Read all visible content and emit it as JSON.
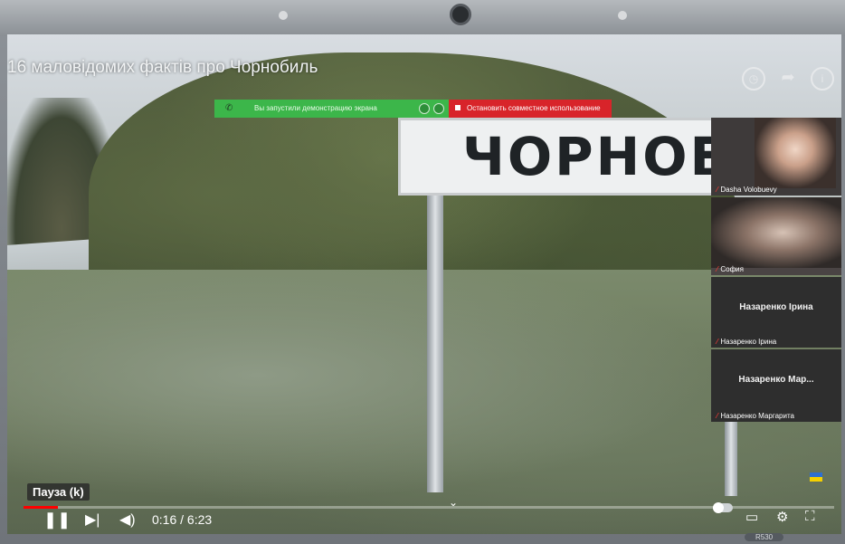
{
  "video": {
    "title": "16 маловідомих фактів про Чорнобиль",
    "sign_text": "ЧОРНОБИЛЬ",
    "pause_tooltip": "Пауза (k)",
    "time": "0:16 / 6:23",
    "progress": 0.042
  },
  "share_bar": {
    "notice": "Вы запустили демонстрацию экрана",
    "stop_label": "Остановить совместное использование",
    "notice_color": "#3cb64a",
    "stop_color": "#d8242a"
  },
  "participants": [
    {
      "name": "Dasha Volobuevy",
      "has_video": true
    },
    {
      "name": "София",
      "has_video": true
    },
    {
      "name": "Назаренко Ірина",
      "center_label": "Назаренко Ірина",
      "has_video": false
    },
    {
      "name": "Назаренко Маргарита",
      "center_label": "Назаренко Мар...",
      "has_video": false
    }
  ],
  "laptop": {
    "model": "R530"
  },
  "icons": {
    "top": [
      "watch-later-icon",
      "share-icon",
      "info-icon"
    ],
    "controls": [
      "play-pause-icon",
      "next-icon",
      "volume-icon",
      "autoplay-toggle-icon",
      "subtitles-icon",
      "settings-icon",
      "fullscreen-icon"
    ]
  }
}
